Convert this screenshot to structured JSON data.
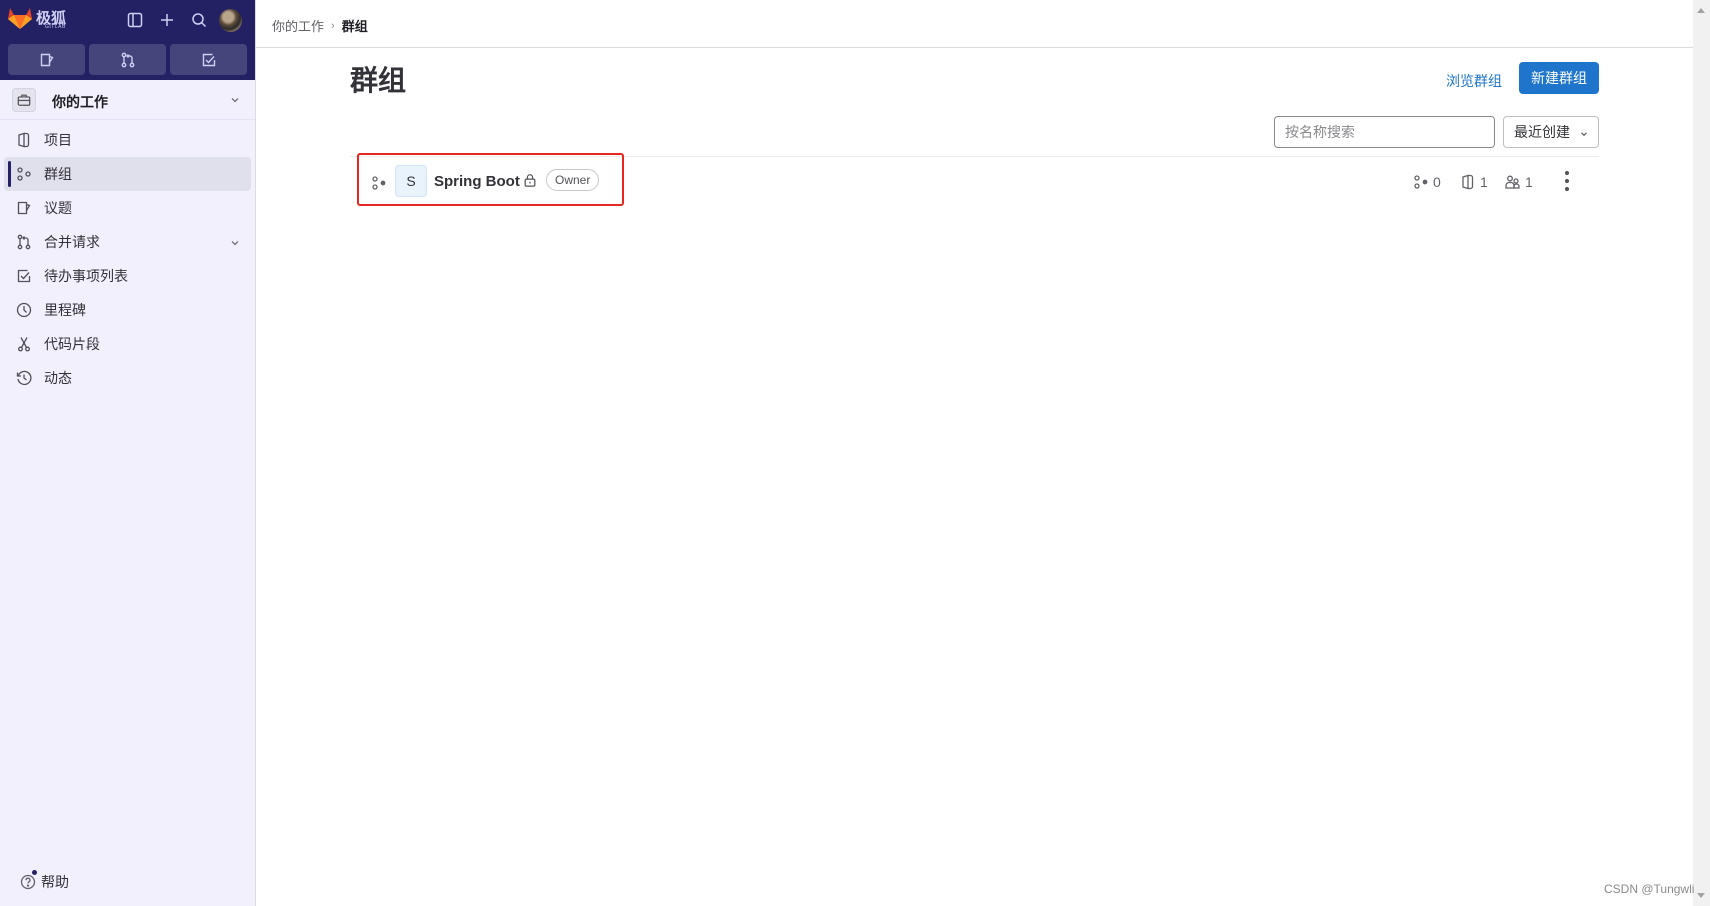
{
  "brand": {
    "name": "极狐",
    "sub": "GITLAB",
    "colors": {
      "sidebar_dark": "#232163",
      "accent": "#1f75cb",
      "highlight": "#e5271f"
    }
  },
  "topbar": {
    "icons": [
      "sidebar-toggle-icon",
      "plus-icon",
      "search-icon",
      "user-avatar"
    ],
    "quick_buttons": [
      {
        "name": "issues",
        "icon": "issues-icon"
      },
      {
        "name": "merge-requests",
        "icon": "merge-request-icon"
      },
      {
        "name": "todos",
        "icon": "todo-icon"
      }
    ]
  },
  "sidebar": {
    "context_label": "你的工作",
    "items": [
      {
        "label": "项目",
        "icon": "project-icon",
        "active": false
      },
      {
        "label": "群组",
        "icon": "group-icon",
        "active": true
      },
      {
        "label": "议题",
        "icon": "issues-icon",
        "active": false
      },
      {
        "label": "合并请求",
        "icon": "merge-request-icon",
        "active": false,
        "expandable": true
      },
      {
        "label": "待办事项列表",
        "icon": "todo-icon",
        "active": false
      },
      {
        "label": "里程碑",
        "icon": "clock-icon",
        "active": false
      },
      {
        "label": "代码片段",
        "icon": "snippet-icon",
        "active": false
      },
      {
        "label": "动态",
        "icon": "history-icon",
        "active": false
      }
    ],
    "help_label": "帮助"
  },
  "breadcrumb": {
    "parent": "你的工作",
    "separator": "›",
    "current": "群组"
  },
  "page": {
    "title": "群组",
    "browse_link": "浏览群组",
    "new_button": "新建群组",
    "search_placeholder": "按名称搜索",
    "search_value": "",
    "sort_label": "最近创建"
  },
  "groups": [
    {
      "avatar_letter": "S",
      "name": "Spring Boot",
      "visibility": "private",
      "role": "Owner",
      "subgroups": "0",
      "projects": "1",
      "members": "1"
    }
  ],
  "watermark": "CSDN @Tungwli"
}
